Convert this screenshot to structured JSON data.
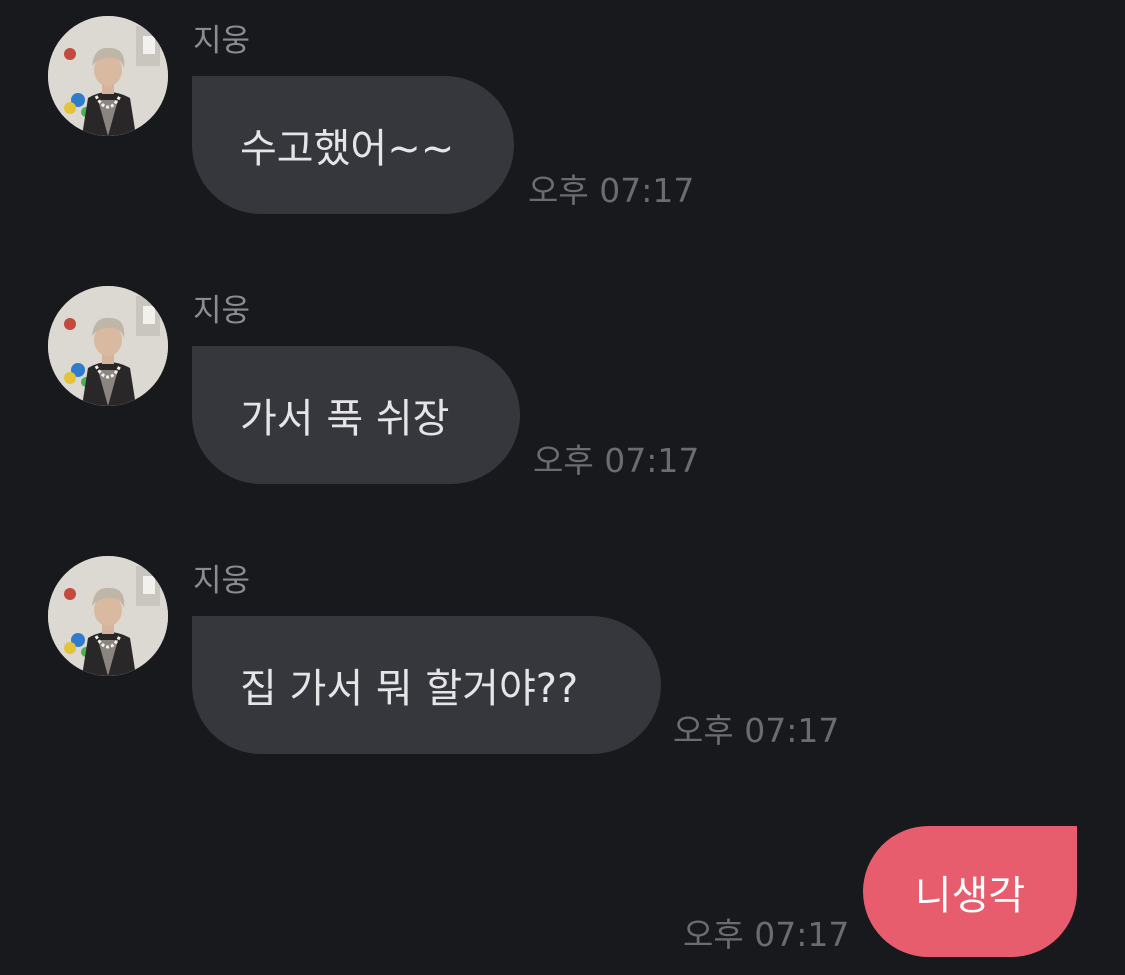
{
  "messages": [
    {
      "sender": "지웅",
      "text": "수고했어~~",
      "time": "오후 07:17",
      "direction": "incoming",
      "avatar_icon": "user-avatar-photo"
    },
    {
      "sender": "지웅",
      "text": "가서 푹 쉬장",
      "time": "오후 07:17",
      "direction": "incoming",
      "avatar_icon": "user-avatar-photo"
    },
    {
      "sender": "지웅",
      "text": "집 가서 뭐 할거야??",
      "time": "오후 07:17",
      "direction": "incoming",
      "avatar_icon": "user-avatar-photo"
    },
    {
      "text": "니생각",
      "time": "오후 07:17",
      "direction": "outgoing"
    }
  ],
  "colors": {
    "background": "#18191d",
    "incoming_bubble": "#36373c",
    "outgoing_bubble": "#e85d6e",
    "sender_text": "#8b8c91",
    "time_text": "#6b6c71"
  }
}
